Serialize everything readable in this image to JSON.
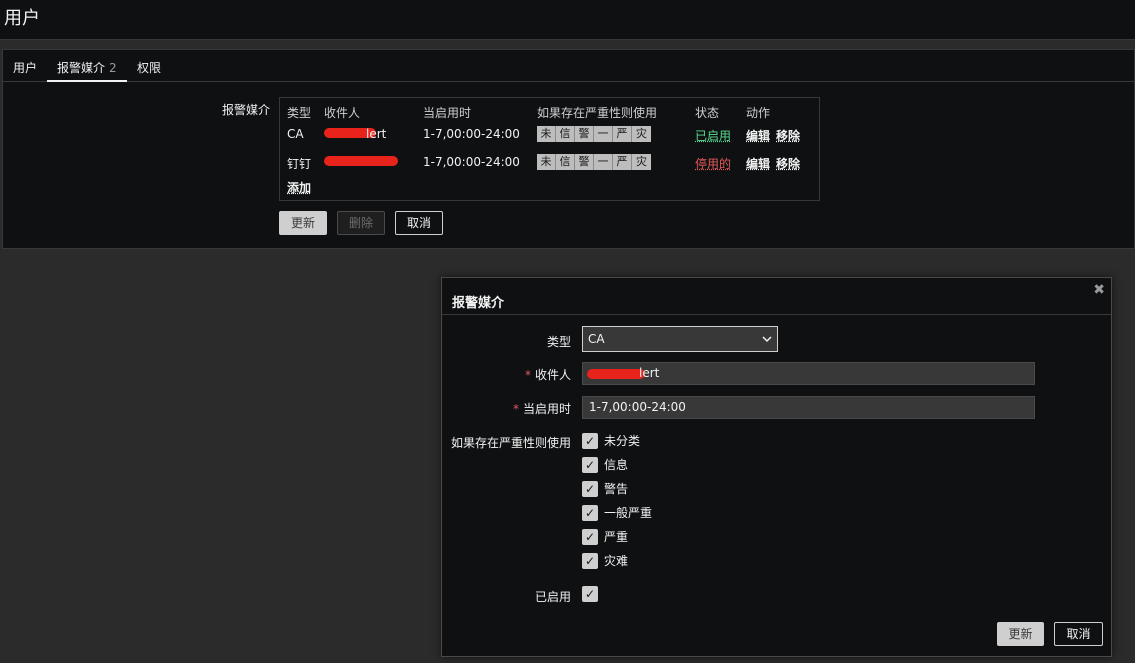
{
  "page": {
    "title": "用户"
  },
  "tabs": [
    {
      "label": "用户"
    },
    {
      "label": "报警媒介",
      "count": "2"
    },
    {
      "label": "权限"
    }
  ],
  "media": {
    "label": "报警媒介",
    "headers": {
      "type": "类型",
      "recipient": "收件人",
      "when": "当启用时",
      "severity": "如果存在严重性则使用",
      "status": "状态",
      "action": "动作"
    },
    "rows": [
      {
        "type": "CA",
        "recipient_suffix": "lert",
        "when": "1-7,00:00-24:00",
        "status": "已启用",
        "edit": "编辑",
        "remove": "移除"
      },
      {
        "type": "钉钉",
        "recipient_suffix": "",
        "when": "1-7,00:00-24:00",
        "status": "停用的",
        "edit": "编辑",
        "remove": "移除"
      }
    ],
    "severity_letters": [
      "未",
      "信",
      "警",
      "一",
      "严",
      "灾"
    ],
    "add_label": "添加",
    "status_colors": {
      "enabled": "#59db8f",
      "disabled": "#e45959"
    }
  },
  "form_buttons": {
    "update": "更新",
    "delete": "删除",
    "cancel": "取消"
  },
  "dialog": {
    "title": "报警媒介",
    "close_icon": "close-icon",
    "type_label": "类型",
    "type_value": "CA",
    "recipient_label": "收件人",
    "recipient_suffix": "lert",
    "when_label": "当启用时",
    "when_value": "1-7,00:00-24:00",
    "severity_label": "如果存在严重性则使用",
    "severities": [
      "未分类",
      "信息",
      "警告",
      "一般严重",
      "严重",
      "灾难"
    ],
    "enabled_label": "已启用",
    "update": "更新",
    "cancel": "取消"
  }
}
